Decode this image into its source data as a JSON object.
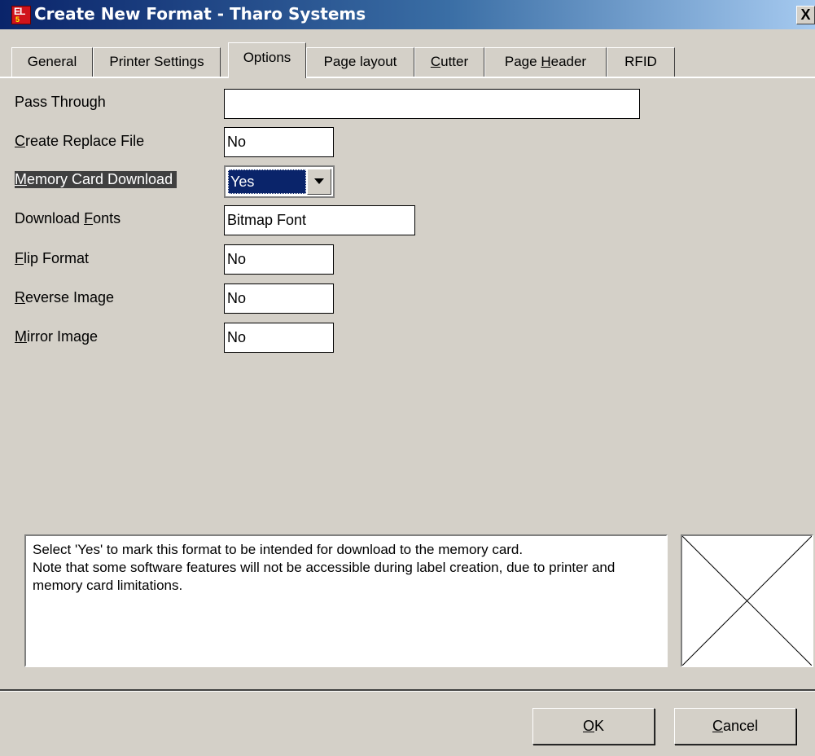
{
  "window": {
    "title": "Create New Format - Tharo Systems",
    "icon_text": "EL",
    "icon_sub": "5",
    "close_glyph": "X",
    "icon_color": "#d0141c"
  },
  "tabs": [
    {
      "pre": "General",
      "acc": "",
      "post": ""
    },
    {
      "pre": "Printer Settings",
      "acc": "",
      "post": ""
    },
    {
      "pre": "Options",
      "acc": "",
      "post": ""
    },
    {
      "pre": "Page layout",
      "acc": "",
      "post": ""
    },
    {
      "pre": "",
      "acc": "C",
      "post": "utter"
    },
    {
      "pre": "Page ",
      "acc": "H",
      "post": "eader"
    },
    {
      "pre": "RFID",
      "acc": "",
      "post": ""
    }
  ],
  "active_tab": "Options",
  "options": {
    "pass_through": {
      "pre": "Pass Through",
      "acc": "",
      "post": "",
      "value": ""
    },
    "create_replace": {
      "pre": "",
      "acc": "C",
      "post": "reate Replace File",
      "value": "No"
    },
    "memory_card": {
      "pre": "",
      "acc": "M",
      "post": "emory Card Download",
      "value": "Yes"
    },
    "download_fonts": {
      "pre": "Download ",
      "acc": "F",
      "post": "onts",
      "value": "Bitmap Font"
    },
    "flip_format": {
      "pre": "",
      "acc": "F",
      "post": "lip Format",
      "value": "No"
    },
    "reverse_image": {
      "pre": "",
      "acc": "R",
      "post": "everse Image",
      "value": "No"
    },
    "mirror_image": {
      "pre": "",
      "acc": "M",
      "post": "irror Image",
      "value": "No"
    }
  },
  "help": {
    "line1": "Select 'Yes' to mark this format to be intended for download to the memory card.",
    "line2": "Note that some software features will not be accessible during label creation, due to printer and memory card limitations."
  },
  "buttons": {
    "ok": {
      "acc": "O",
      "post": "K"
    },
    "cancel": {
      "acc": "C",
      "post": "ancel"
    }
  }
}
